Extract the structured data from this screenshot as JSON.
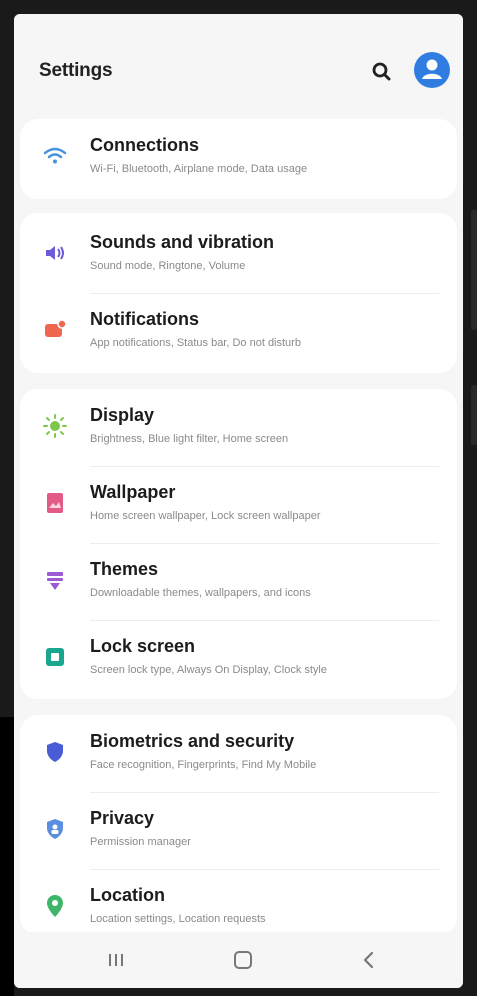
{
  "header": {
    "title": "Settings",
    "search_icon": "search-icon",
    "account_icon": "account-icon"
  },
  "groups": [
    {
      "items": [
        {
          "title": "Connections",
          "subtitle": "Wi-Fi, Bluetooth, Airplane mode, Data usage",
          "icon": "wifi-icon",
          "color": "#4a90e2"
        }
      ]
    },
    {
      "items": [
        {
          "title": "Sounds and vibration",
          "subtitle": "Sound mode, Ringtone, Volume",
          "icon": "volume-icon",
          "color": "#6b5bd6"
        },
        {
          "title": "Notifications",
          "subtitle": "App notifications, Status bar, Do not disturb",
          "icon": "notification-icon",
          "color": "#f0674f"
        }
      ]
    },
    {
      "items": [
        {
          "title": "Display",
          "subtitle": "Brightness, Blue light filter, Home screen",
          "icon": "brightness-icon",
          "color": "#7bc94a"
        },
        {
          "title": "Wallpaper",
          "subtitle": "Home screen wallpaper, Lock screen wallpaper",
          "icon": "wallpaper-icon",
          "color": "#e35a86"
        },
        {
          "title": "Themes",
          "subtitle": "Downloadable themes, wallpapers, and icons",
          "icon": "themes-icon",
          "color": "#9c5ad6"
        },
        {
          "title": "Lock screen",
          "subtitle": "Screen lock type, Always On Display, Clock style",
          "icon": "lock-screen-icon",
          "color": "#1aa58f"
        }
      ]
    },
    {
      "items": [
        {
          "title": "Biometrics and security",
          "subtitle": "Face recognition, Fingerprints, Find My Mobile",
          "icon": "shield-icon",
          "color": "#4a5bd6"
        },
        {
          "title": "Privacy",
          "subtitle": "Permission manager",
          "icon": "privacy-icon",
          "color": "#5b8de0"
        },
        {
          "title": "Location",
          "subtitle": "Location settings, Location requests",
          "icon": "location-icon",
          "color": "#3fb56a"
        }
      ]
    }
  ],
  "navbar": {
    "recents_icon": "recents-icon",
    "home_icon": "home-icon",
    "back_icon": "back-icon"
  }
}
